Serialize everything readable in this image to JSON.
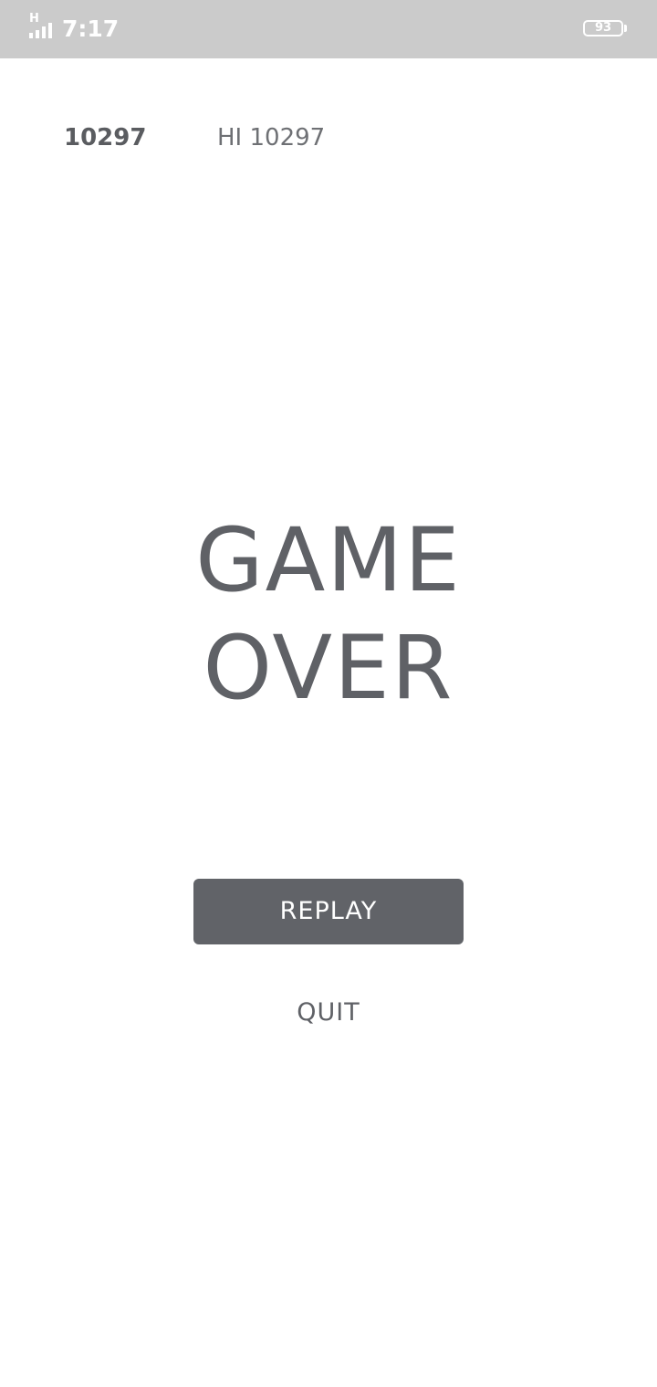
{
  "status_bar": {
    "network_label": "H",
    "time": "7:17",
    "battery_level": "93",
    "icons": {
      "signal": "signal-icon",
      "battery": "battery-icon"
    }
  },
  "scores": {
    "current": "10297",
    "high": "HI 10297"
  },
  "title": {
    "line1": "GAME",
    "line2": "OVER"
  },
  "buttons": {
    "replay_label": "REPLAY",
    "quit_label": "QUIT"
  },
  "colors": {
    "status_bar_bg": "#cbcbcb",
    "primary_gray": "#616368",
    "background": "#ffffff"
  }
}
